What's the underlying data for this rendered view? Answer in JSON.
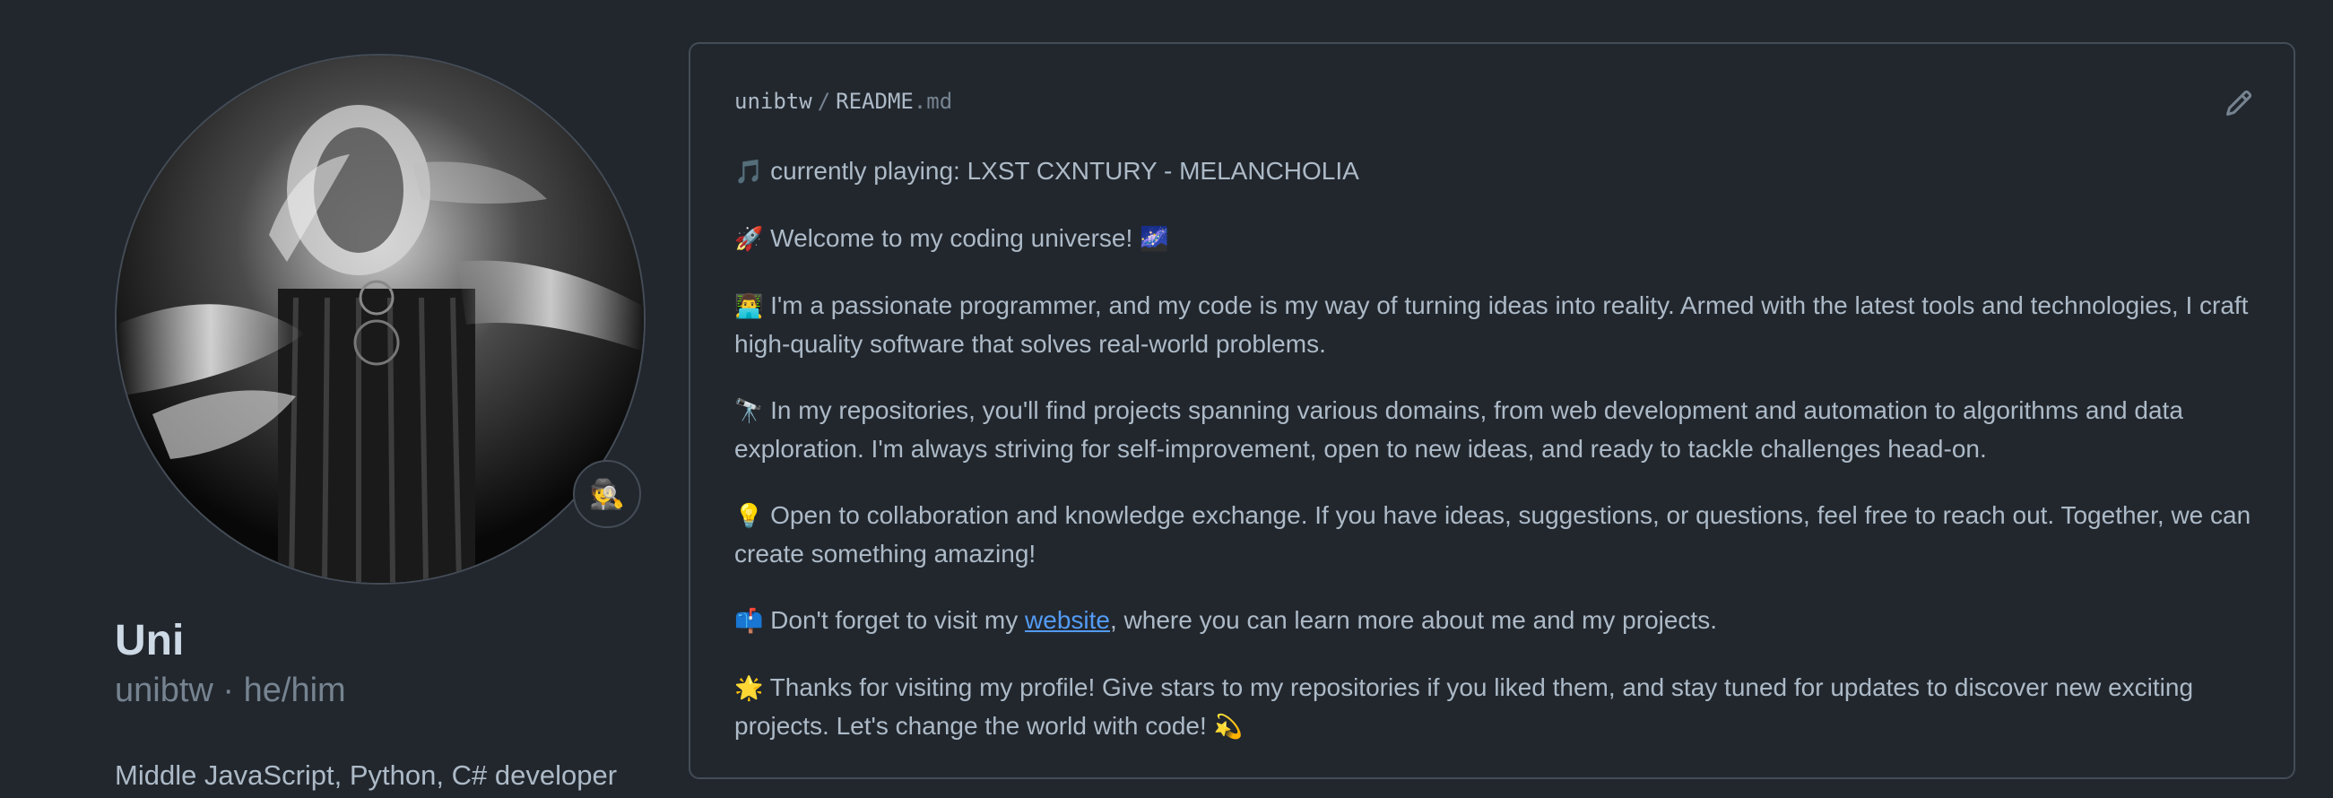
{
  "profile": {
    "name": "Uni",
    "username": "unibtw",
    "separator": " · ",
    "pronouns": "he/him",
    "bio": "Middle JavaScript, Python, C# developer",
    "status_emoji": "🕵️"
  },
  "readme": {
    "owner": "unibtw",
    "slash": "/",
    "filename": "README",
    "extension": ".md",
    "paragraphs": [
      {
        "emoji": "🎵",
        "text": "currently playing: LXST CXNTURY - MELANCHOLIA"
      },
      {
        "emoji": "🚀",
        "text": "Welcome to my coding universe!",
        "trailing_emoji": "🌌"
      },
      {
        "emoji": "👨‍💻",
        "text": "I'm a passionate programmer, and my code is my way of turning ideas into reality. Armed with the latest tools and technologies, I craft high-quality software that solves real-world problems."
      },
      {
        "emoji": "🔭",
        "text": "In my repositories, you'll find projects spanning various domains, from web development and automation to algorithms and data exploration. I'm always striving for self-improvement, open to new ideas, and ready to tackle challenges head-on."
      },
      {
        "emoji": "💡",
        "text": "Open to collaboration and knowledge exchange. If you have ideas, suggestions, or questions, feel free to reach out. Together, we can create something amazing!"
      },
      {
        "emoji": "📫",
        "text_before": "Don't forget to visit my ",
        "link_text": "website",
        "text_after": ", where you can learn more about me and my projects."
      },
      {
        "emoji": "🌟",
        "text": "Thanks for visiting my profile! Give stars to my repositories if you liked them, and stay tuned for updates to discover new exciting projects. Let's change the world with code!",
        "trailing_emoji": "💫"
      }
    ]
  },
  "icons": {
    "edit": "pencil-icon",
    "status": "detective-emoji-icon"
  },
  "colors": {
    "background": "#22272e",
    "border": "#444c56",
    "text": "#adbac7",
    "text_strong": "#cdd9e5",
    "muted": "#768390",
    "link": "#539bf5"
  }
}
